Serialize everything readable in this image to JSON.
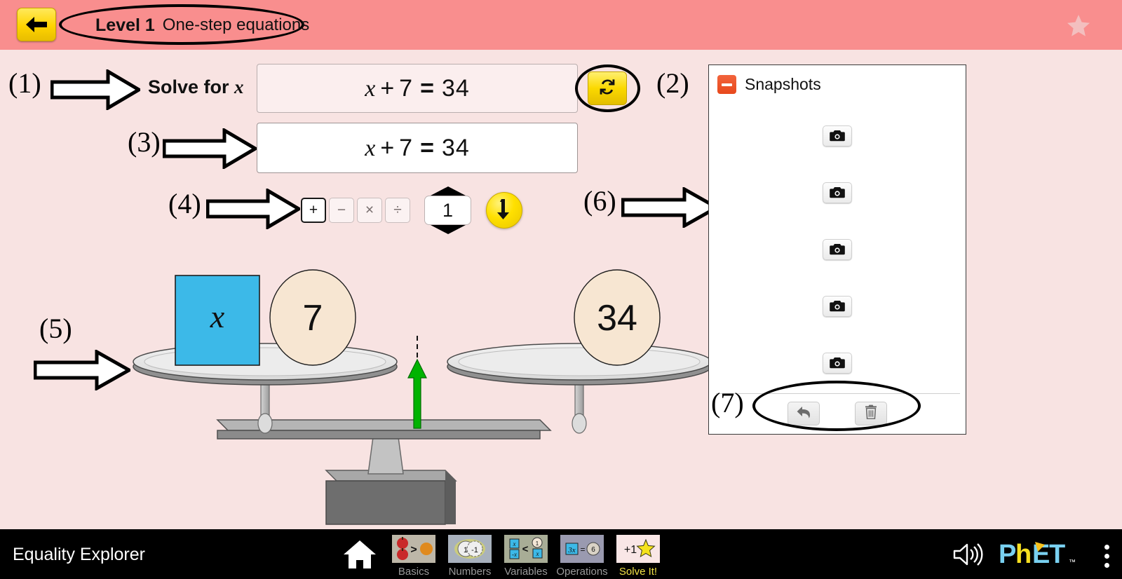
{
  "header": {
    "back_icon": "back-arrow-icon",
    "level_number": "Level 1",
    "level_description": "One-step equations",
    "star_icon": "star-icon"
  },
  "callouts": {
    "c1": "(1)",
    "c2": "(2)",
    "c3": "(3)",
    "c4": "(4)",
    "c5": "(5)",
    "c6": "(6)",
    "c7": "(7)"
  },
  "challenge": {
    "solve_for_prefix": "Solve for",
    "solve_for_variable": "x",
    "equation": {
      "left_variable": "x",
      "operator": "+",
      "left_constant": "7",
      "equals": "=",
      "right": "34"
    }
  },
  "equation_display": {
    "left_variable": "x",
    "operator": "+",
    "left_constant": "7",
    "equals": "=",
    "right": "34"
  },
  "refresh": {
    "icon": "refresh-icon",
    "label": ""
  },
  "operations": {
    "buttons": [
      {
        "label": "+",
        "name": "operator-plus",
        "selected": true
      },
      {
        "label": "−",
        "name": "operator-minus",
        "selected": false
      },
      {
        "label": "×",
        "name": "operator-times",
        "selected": false
      },
      {
        "label": "÷",
        "name": "operator-divide",
        "selected": false
      }
    ],
    "operand_value": "1",
    "apply_icon": "apply-down-arrow-icon"
  },
  "snapshots": {
    "title": "Snapshots",
    "collapse_icon": "collapse-minus-icon",
    "rows": [
      {
        "name": "snapshot-row-1",
        "camera_icon": "camera-icon"
      },
      {
        "name": "snapshot-row-2",
        "camera_icon": "camera-icon"
      },
      {
        "name": "snapshot-row-3",
        "camera_icon": "camera-icon"
      },
      {
        "name": "snapshot-row-4",
        "camera_icon": "camera-icon"
      },
      {
        "name": "snapshot-row-5",
        "camera_icon": "camera-icon"
      }
    ],
    "undo_icon": "undo-arrow-icon",
    "trash_icon": "trash-icon"
  },
  "scale": {
    "left_plate": [
      {
        "type": "variable-tile",
        "label": "x",
        "color": "#3cb9e8"
      },
      {
        "type": "constant-circle",
        "label": "7",
        "color": "#f7e6d2"
      }
    ],
    "right_plate": [
      {
        "type": "constant-circle",
        "label": "34",
        "color": "#f7e6d2"
      }
    ],
    "balanced": true,
    "arrow_color": "#00b300"
  },
  "navbar": {
    "sim_title": "Equality Explorer",
    "home_icon": "home-icon",
    "tabs": [
      {
        "label": "Basics",
        "name": "tab-basics",
        "active": false
      },
      {
        "label": "Numbers",
        "name": "tab-numbers",
        "active": false
      },
      {
        "label": "Variables",
        "name": "tab-variables",
        "active": false
      },
      {
        "label": "Operations",
        "name": "tab-operations",
        "active": false
      },
      {
        "label": "Solve It!",
        "name": "tab-solve-it",
        "active": true
      }
    ],
    "sound_icon": "sound-on-icon",
    "logo_text": "PhET",
    "logo_tm": "™",
    "menu_icon": "kebab-menu-icon"
  },
  "colors": {
    "header_bg": "#f98e8e",
    "stage_bg": "#f8e3e2",
    "accent_yellow": "#ffd400",
    "tile_blue": "#3cb9e8",
    "constant_cream": "#f7e6d2",
    "collapse_orange": "#e8491c",
    "navbar_bg": "#000000",
    "active_tab": "#f0e146"
  }
}
